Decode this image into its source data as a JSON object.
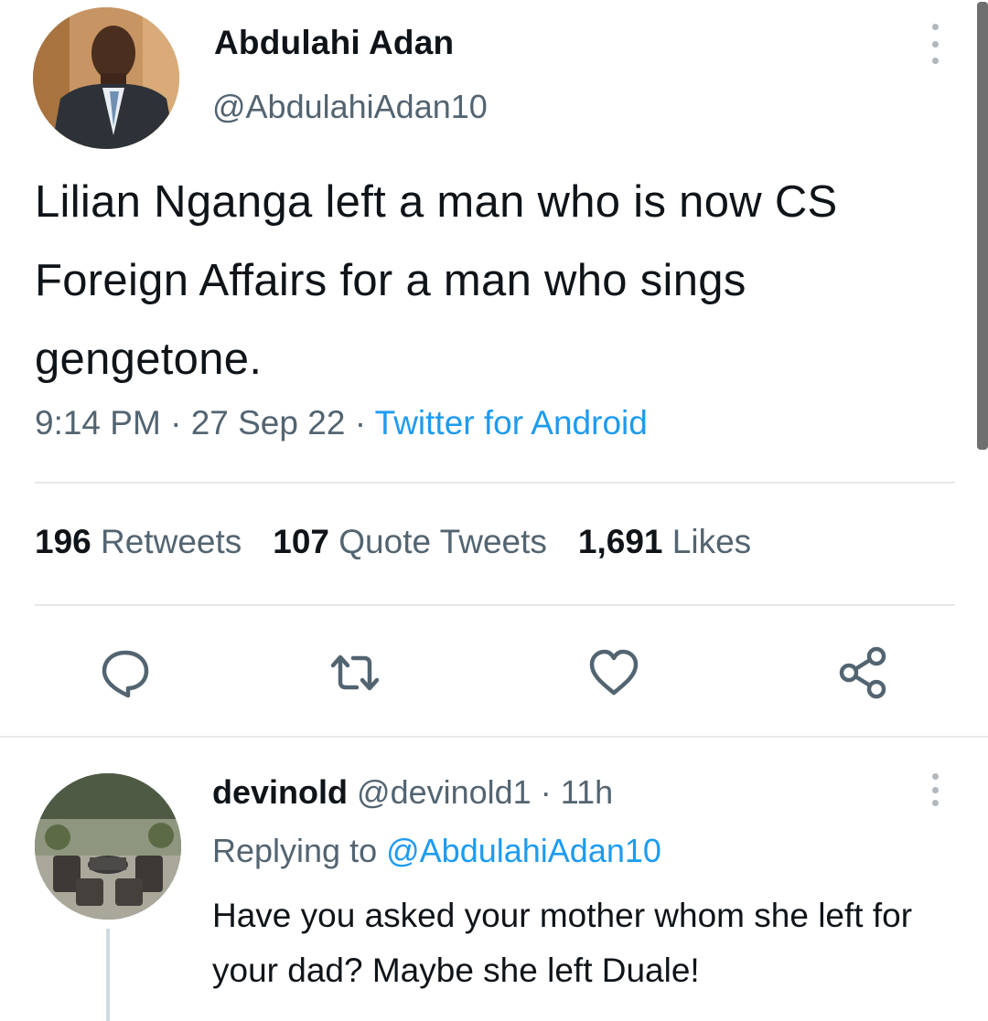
{
  "tweet": {
    "author": {
      "display_name": "Abdulahi Adan",
      "handle": "@AbdulahiAdan10"
    },
    "text": "Lilian Nganga  left a man who is now CS Foreign Affairs for a man who sings gengetone.",
    "time": "9:14 PM",
    "date": "27 Sep 22",
    "separator": "·",
    "source": "Twitter for Android",
    "stats": {
      "retweets_count": "196",
      "retweets_label": "Retweets",
      "quotes_count": "107",
      "quotes_label": "Quote Tweets",
      "likes_count": "1,691",
      "likes_label": "Likes"
    },
    "actions": [
      "reply-icon",
      "retweet-icon",
      "like-icon",
      "share-icon"
    ]
  },
  "reply": {
    "display_name": "devinold",
    "handle": "@devinold1",
    "separator": "·",
    "age": "11h",
    "replying_prefix": "Replying to",
    "replying_to": "@AbdulahiAdan10",
    "text": "Have you asked your mother whom she left for your dad? Maybe she left Duale!"
  },
  "colors": {
    "text": "#0f1419",
    "secondary": "#536471",
    "accent": "#1d9bf0",
    "divider": "#e6e9eb"
  }
}
